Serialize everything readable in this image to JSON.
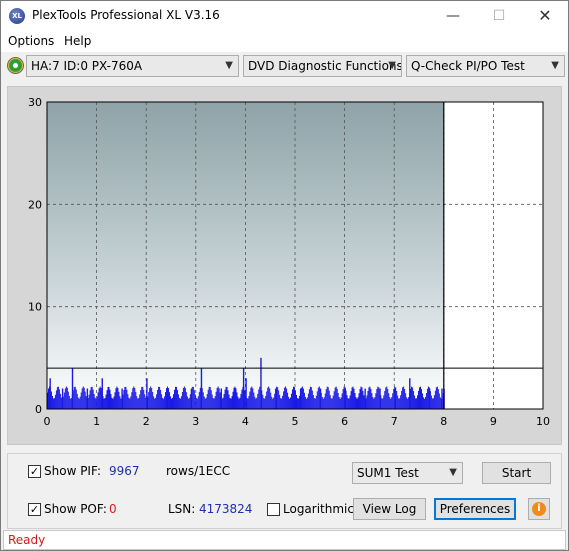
{
  "window": {
    "title": "PlexTools Professional XL V3.16",
    "icon_text": "XL",
    "controls": {
      "minimize": "—",
      "maximize": "☐",
      "close": "✕"
    }
  },
  "menu": {
    "items": [
      "Options",
      "Help"
    ]
  },
  "toolbar": {
    "drive": "HA:7 ID:0  PX-760A",
    "function": "DVD Diagnostic Functions",
    "test": "Q-Check PI/PO Test"
  },
  "chart_data": {
    "type": "bar",
    "xlim": [
      0,
      10
    ],
    "ylim": [
      0,
      30
    ],
    "x_ticks": [
      "0",
      "1",
      "2",
      "3",
      "4",
      "5",
      "6",
      "7",
      "8",
      "9",
      "10"
    ],
    "y_ticks": [
      "0",
      "10",
      "20",
      "30"
    ],
    "grid": true,
    "threshold_line": 4,
    "end_position": 8,
    "series": [
      {
        "color": "#1a1ae6",
        "x": [
          0.05,
          0.3,
          0.5,
          0.8,
          1.1,
          1.5,
          2.0,
          2.4,
          2.9,
          3.1,
          3.5,
          3.95,
          4.0,
          4.3,
          4.6,
          5.1,
          5.5,
          6.0,
          6.4,
          6.7,
          7.0,
          7.3,
          7.7,
          7.95
        ],
        "values": [
          3,
          2,
          4,
          2,
          3,
          2,
          3,
          2,
          2,
          4,
          2,
          4,
          3,
          5,
          2,
          2,
          2,
          2,
          2,
          2,
          2,
          3,
          2,
          2
        ]
      }
    ]
  },
  "controls": {
    "show_pif_label": "Show PIF:",
    "pif_value": "9967",
    "rows_label": "rows/1ECC",
    "show_pof_label": "Show POF:",
    "pof_value": "0",
    "lsn_label": "LSN:",
    "lsn_value": "4173824",
    "logarithmic_label": "Logarithmic",
    "sum_select": "SUM1 Test",
    "start_button": "Start",
    "view_log_button": "View Log",
    "preferences_button": "Preferences",
    "info_icon": "i"
  },
  "status": {
    "text": "Ready"
  }
}
